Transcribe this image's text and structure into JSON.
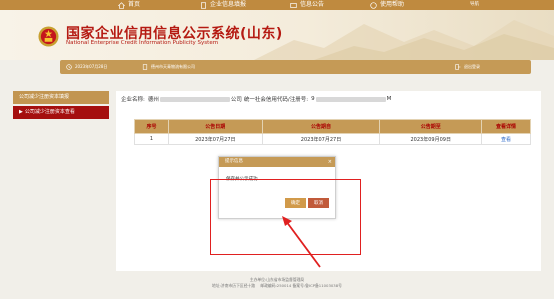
{
  "topnav": {
    "items": [
      {
        "label": "首页",
        "icon": "home-icon"
      },
      {
        "label": "企业信息填报",
        "icon": "report-icon"
      },
      {
        "label": "信息公告",
        "icon": "notice-icon"
      },
      {
        "label": "使用帮助",
        "icon": "help-icon"
      },
      {
        "label": "导航",
        "icon": ""
      }
    ]
  },
  "header": {
    "title": "国家企业信用信息公示系统(山东)",
    "subtitle": "National Enterprise Credit Information Publicity System"
  },
  "infobar": {
    "date": "2023年07月28日",
    "company": "德州市天青物流有限公司",
    "logout": "退出登录"
  },
  "sidebar": {
    "items": [
      {
        "label": "公司减少注册资本填报",
        "active": false
      },
      {
        "label": "公司减少注册资本查看",
        "active": true
      }
    ]
  },
  "company": {
    "name_prefix": "企业名称:",
    "name_start": "德州",
    "name_end": "公司",
    "code_label": "统一社会信用代码/注册号:",
    "code_start": "9",
    "code_end": "M"
  },
  "table": {
    "headers": [
      "序号",
      "公告日期",
      "公告期自",
      "公告期至",
      "查看详情"
    ],
    "rows": [
      [
        "1",
        "2023年07月27日",
        "2023年07月27日",
        "2023年09月09日",
        "查看"
      ]
    ]
  },
  "dialog": {
    "title": "提示信息",
    "close": "×",
    "message": "保存并公示成功",
    "ok_label": "确定",
    "cancel_label": "取消"
  },
  "footer": {
    "line1": "主办单位:山东省市场监督管理局",
    "line2": "地址:济南市历下区经十路",
    "line3": "邮政编码:250014   备案号:鲁ICP备11003038号"
  },
  "colors": {
    "gold": "#c59a56",
    "red": "#b51a12",
    "annotation": "#e02020"
  }
}
